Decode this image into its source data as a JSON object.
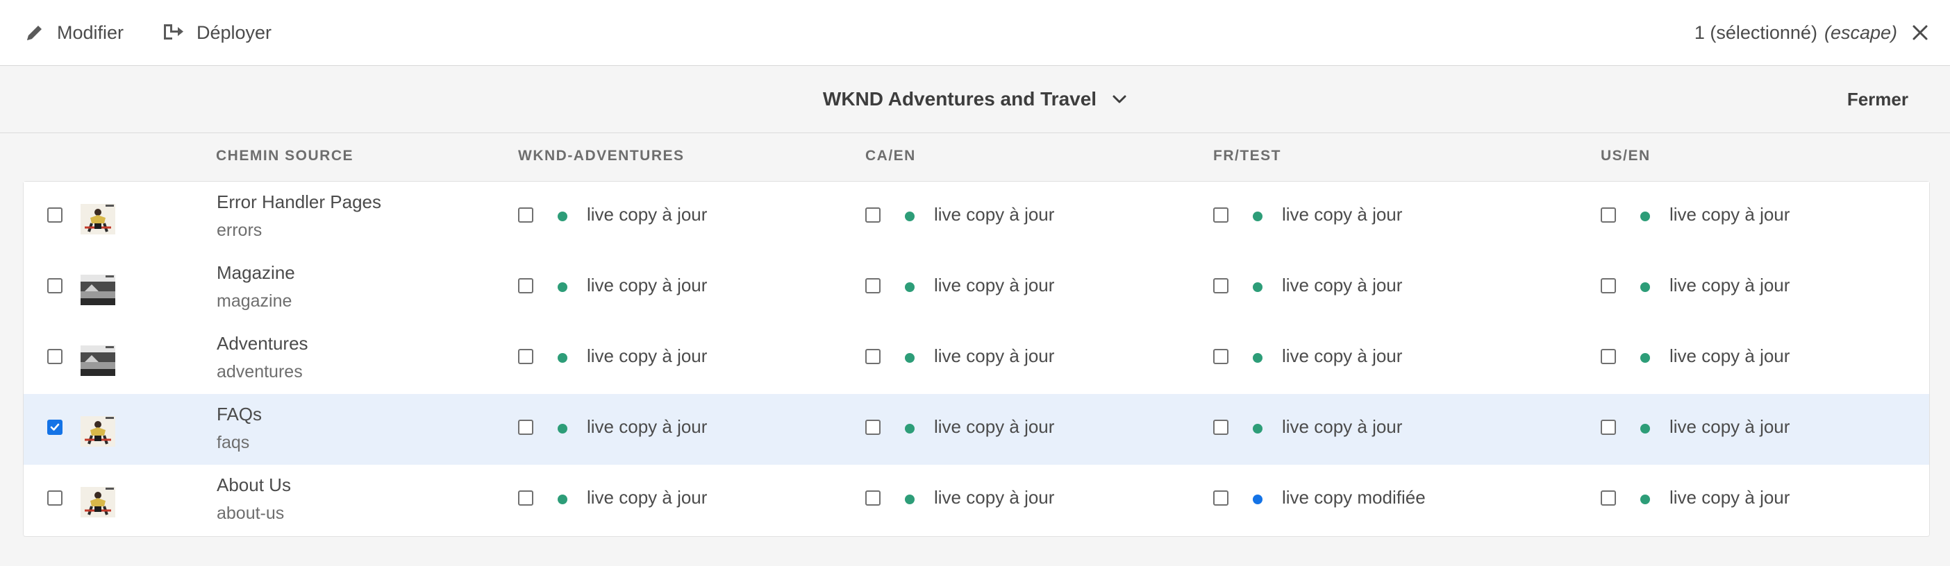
{
  "toolbar": {
    "edit_label": "Modifier",
    "deploy_label": "Déployer",
    "selection_count": "1 (sélectionné)",
    "escape_hint": "(escape)"
  },
  "panel": {
    "title": "WKND Adventures and Travel",
    "close_label": "Fermer"
  },
  "columns": {
    "source": "CHEMIN SOURCE",
    "targets": [
      "WKND-ADVENTURES",
      "CA/EN",
      "FR/TEST",
      "US/EN"
    ]
  },
  "colors": {
    "status_ok": "#2d9d78",
    "status_modified": "#1473e6",
    "selection_bg": "#e8f0fb",
    "checkbox_checked": "#1473e6"
  },
  "rows": [
    {
      "title": "Error Handler Pages",
      "path": "errors",
      "selected": false,
      "thumbnail": "person-photo",
      "statuses": [
        "live copy à jour",
        "live copy à jour",
        "live copy à jour",
        "live copy à jour"
      ],
      "status_kinds": [
        "ok",
        "ok",
        "ok",
        "ok"
      ]
    },
    {
      "title": "Magazine",
      "path": "magazine",
      "selected": false,
      "thumbnail": "landscape-photo",
      "statuses": [
        "live copy à jour",
        "live copy à jour",
        "live copy à jour",
        "live copy à jour"
      ],
      "status_kinds": [
        "ok",
        "ok",
        "ok",
        "ok"
      ]
    },
    {
      "title": "Adventures",
      "path": "adventures",
      "selected": false,
      "thumbnail": "landscape-photo",
      "statuses": [
        "live copy à jour",
        "live copy à jour",
        "live copy à jour",
        "live copy à jour"
      ],
      "status_kinds": [
        "ok",
        "ok",
        "ok",
        "ok"
      ]
    },
    {
      "title": "FAQs",
      "path": "faqs",
      "selected": true,
      "thumbnail": "person-photo",
      "statuses": [
        "live copy à jour",
        "live copy à jour",
        "live copy à jour",
        "live copy à jour"
      ],
      "status_kinds": [
        "ok",
        "ok",
        "ok",
        "ok"
      ]
    },
    {
      "title": "About Us",
      "path": "about-us",
      "selected": false,
      "thumbnail": "person-photo",
      "statuses": [
        "live copy à jour",
        "live copy à jour",
        "live copy modifiée",
        "live copy à jour"
      ],
      "status_kinds": [
        "ok",
        "ok",
        "modified",
        "ok"
      ]
    }
  ]
}
